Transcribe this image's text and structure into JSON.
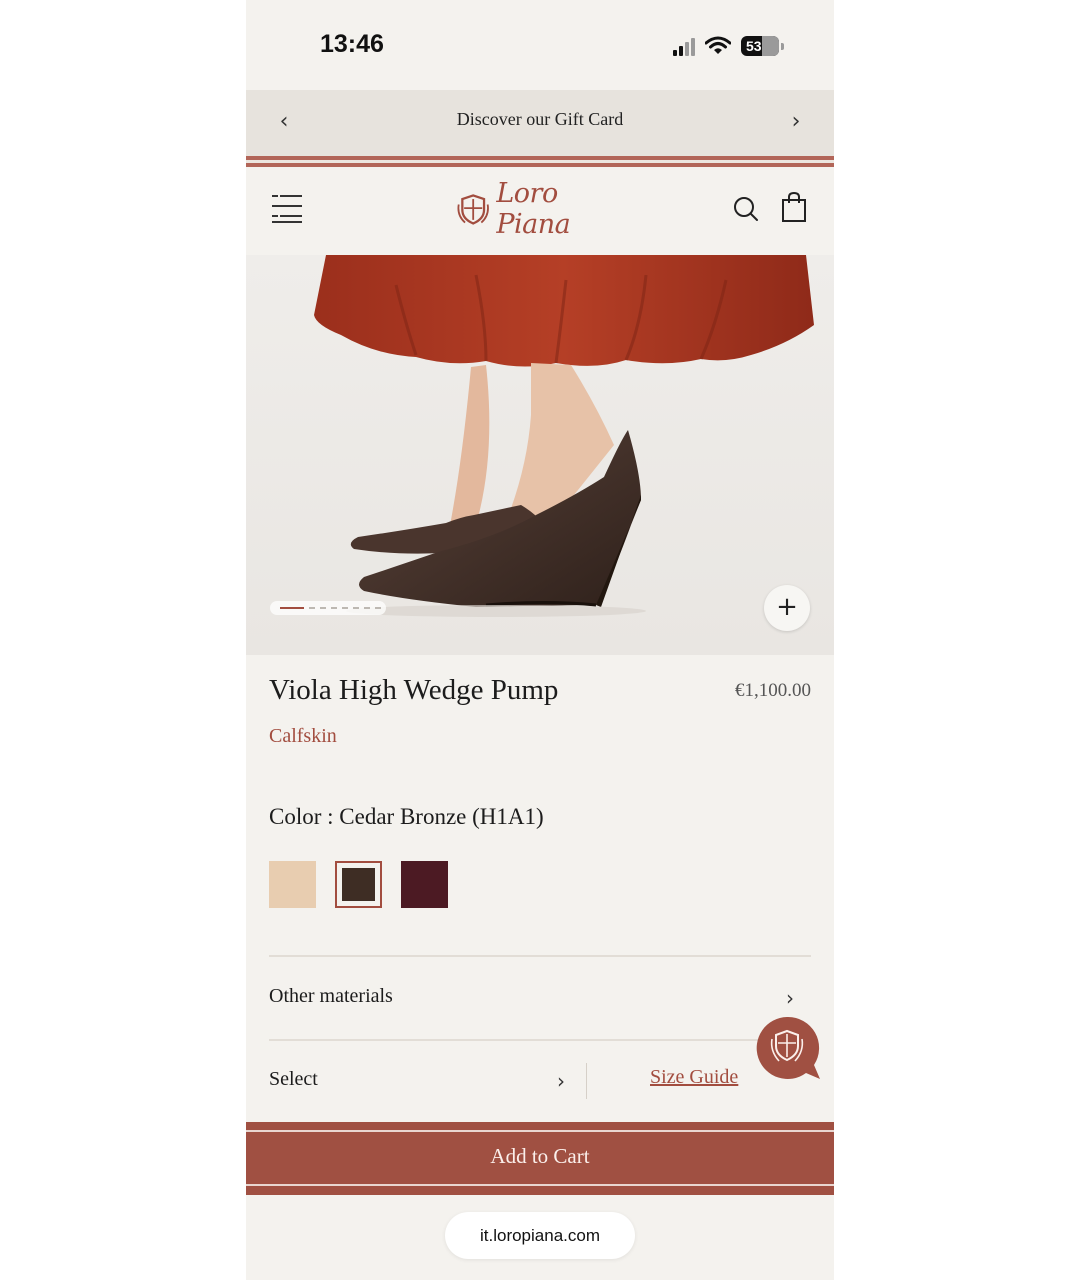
{
  "status_bar": {
    "time": "13:46",
    "battery": "53"
  },
  "promo": {
    "text": "Discover our Gift Card"
  },
  "header": {
    "logo_text": "Loro Piana"
  },
  "product": {
    "title": "Viola High Wedge Pump",
    "price": "€1,100.00",
    "material": "Calfskin",
    "color_label": "Color : Cedar Bronze (H1A1)",
    "swatches": [
      {
        "name": "beige",
        "color": "#e8cdb0",
        "selected": false
      },
      {
        "name": "cedar-bronze",
        "color": "#3e2d24",
        "selected": true
      },
      {
        "name": "burgundy",
        "color": "#4c1a23",
        "selected": false
      }
    ],
    "gallery_pages": 8,
    "gallery_active": 1
  },
  "options": {
    "other_materials": "Other materials",
    "select_size": "Select",
    "size_guide": "Size Guide"
  },
  "cart": {
    "label": "Add to Cart"
  },
  "browser": {
    "url": "it.loropiana.com"
  },
  "colors": {
    "brand": "#a24d3f",
    "cart_bg": "#a05042",
    "page_bg": "#f4f2ee"
  }
}
